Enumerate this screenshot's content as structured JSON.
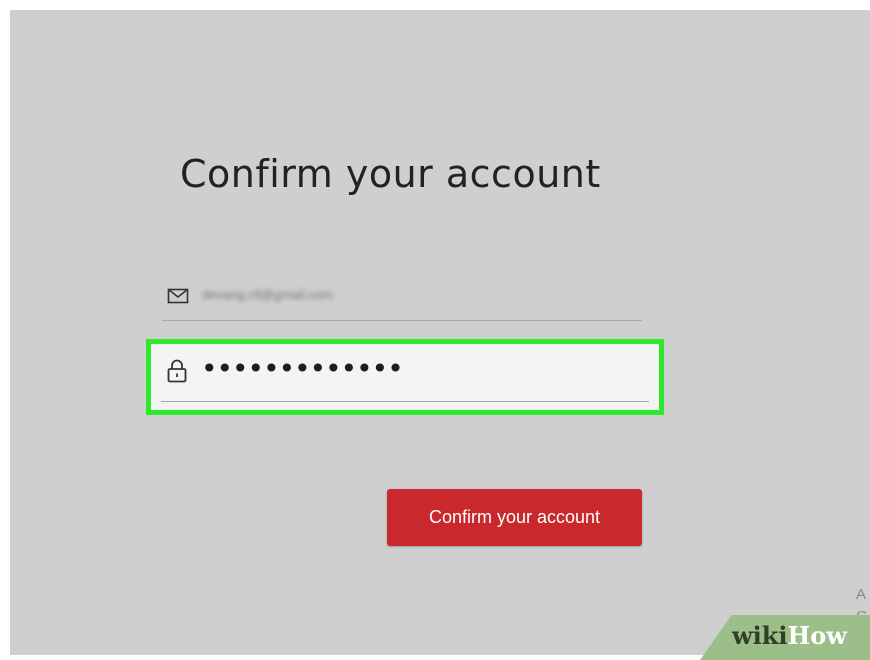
{
  "page": {
    "title": "Confirm your account"
  },
  "email_field": {
    "icon": "mail-icon",
    "value": "devang.cll@gmail.com"
  },
  "password_field": {
    "icon": "lock-icon",
    "value": "•••••••••••••",
    "highlight_color": "#2ee82e"
  },
  "confirm_button": {
    "label": "Confirm your account",
    "color": "#c9282d"
  },
  "edge_text": [
    "A",
    "G"
  ],
  "watermark": {
    "part1": "wiki",
    "part2": "How"
  }
}
